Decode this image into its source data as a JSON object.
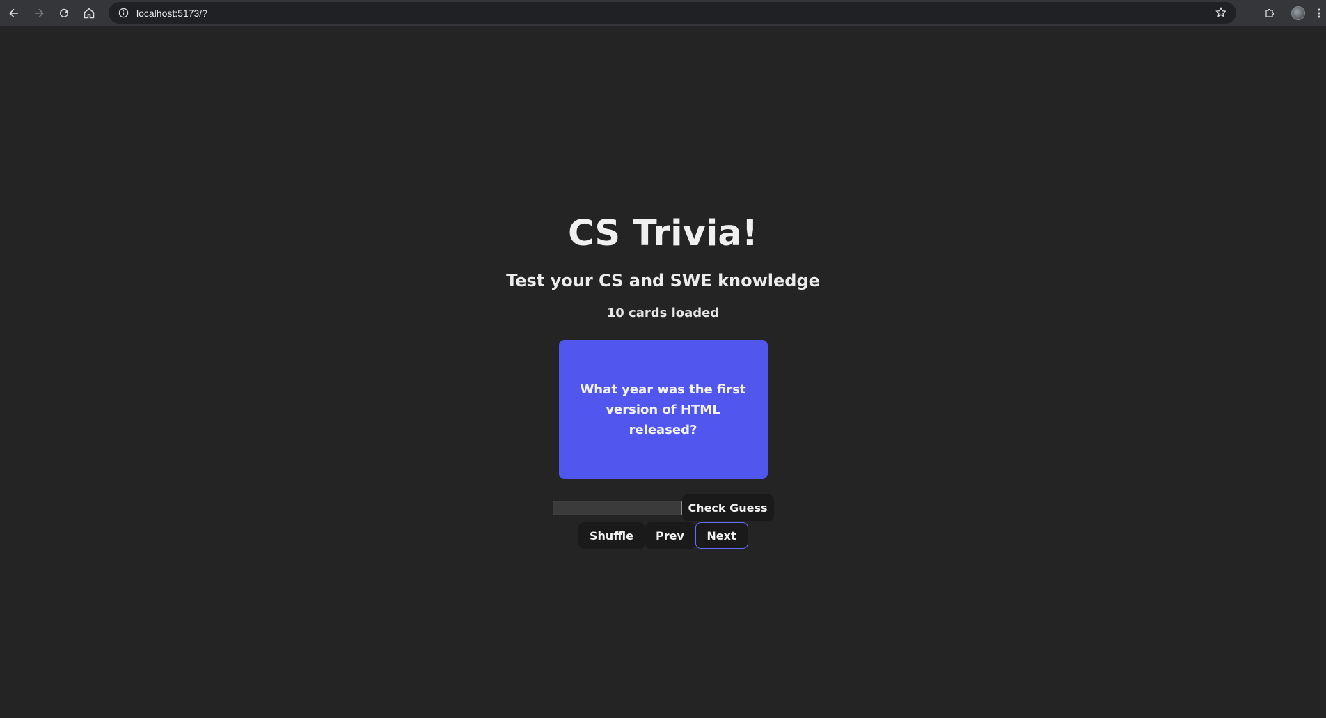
{
  "browser": {
    "url": "localhost:5173/?",
    "back_icon": "arrow-left-icon",
    "forward_icon": "arrow-right-icon",
    "reload_icon": "reload-icon",
    "home_icon": "home-icon",
    "info_icon": "info-icon",
    "star_icon": "star-icon",
    "extensions_icon": "puzzle-icon",
    "profile_icon": "avatar",
    "menu_icon": "kebab-menu-icon"
  },
  "app": {
    "title": "CS Trivia!",
    "subtitle": "Test your CS and SWE knowledge",
    "count": "10 cards loaded",
    "card": {
      "question": "What year was the first version of HTML released?",
      "color": "#5157ee"
    },
    "guess": {
      "value": "",
      "placeholder": "",
      "check_label": "Check Guess"
    },
    "controls": {
      "shuffle_label": "Shuffle",
      "prev_label": "Prev",
      "next_label": "Next",
      "accent": "#646cff"
    }
  }
}
